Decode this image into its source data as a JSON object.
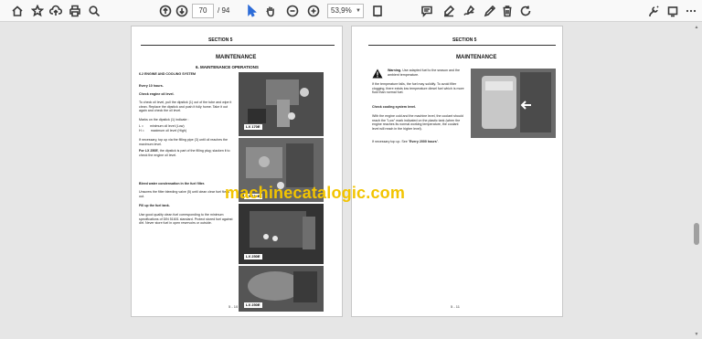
{
  "toolbar": {
    "page_current": "70",
    "page_total": "/ 94",
    "zoom": "53,9%",
    "icons": [
      "home-icon",
      "bookmark-star-icon",
      "upload-icon",
      "print-icon",
      "search-icon",
      "prev-page-icon",
      "next-page-icon",
      "select-cursor-icon",
      "hand-icon",
      "zoom-out-icon",
      "zoom-in-icon",
      "zoom-dropdown-icon",
      "page-view-icon",
      "comment-icon",
      "highlight-icon",
      "sign-icon",
      "draw-icon",
      "delete-icon",
      "rotate-icon",
      "tools-icon",
      "more-icon"
    ]
  },
  "left_page": {
    "section": "SECTION 5",
    "title": "MAINTENANCE",
    "subtitle": "6. MAINTENANCE OPERATIONS",
    "heading": "6.2 ENGINE AND COOLING SYSTEM",
    "every": "Every 10 hours.",
    "check_oil": "Check engine oil level.",
    "p1": "To check oil level, pull the dipstick (1) out of the tube and wipe it clean. Replace the dipstick and push it fully home. Take it out again and check the oil level.",
    "p2": "Marks on the dipstick (1) indicate :",
    "l_label": "L =",
    "l_value": "minimum oil level (Low)",
    "h_label": "H =",
    "h_value": "maximum oil level (High)",
    "p3": "If necessary, top up via the filling pipe (3) until oil reaches the maximum level.",
    "p4_bold": "For LX 250E",
    "p4": ", the dipstick is part of the filling plug; slacken it to check the engine oil level.",
    "bleed_heading": "Bleed water condensation in the fuel filter.",
    "p5": "Unscrew the filter bleeding valve (5) until clean clear fuel flows out.",
    "fill_heading": "Fill up the fuel tank.",
    "p6": "Use good quality clean fuel corresponding to the minimum specifications of DIN 51601 standard. Protect stored fuel against dirt. Never store fuel in open reservoirs or outside.",
    "photo_labels": [
      "LX 170E",
      "LX 210E",
      "LX 250E",
      "LX 250E"
    ],
    "footer": "5 - 10"
  },
  "right_page": {
    "section": "SECTION 5",
    "title": "MAINTENANCE",
    "warning_bold": "Warning.",
    "warning_text": " Use adapted fuel to the season and the ambient temperature.",
    "p1": "If the temperature falls, the fuel may solidify. To avoid filter clogging, there exists low temperature diesel fuel which is more fluid than normal fuel.",
    "coolant_heading": "Check cooling system level.",
    "p2": "With the engine cold and the machine level, the coolant should reach the \"Low\" mark indicated on the plastic tank (when the engine reaches its normal working temperature, the coolant level will reach in the higher level).",
    "p3_pre": "If necessary top up. See \"",
    "p3_bold": "Every 2000 hours",
    "p3_post": "\".",
    "footer": "5 - 11"
  },
  "watermark": "machinecatalogic.com"
}
